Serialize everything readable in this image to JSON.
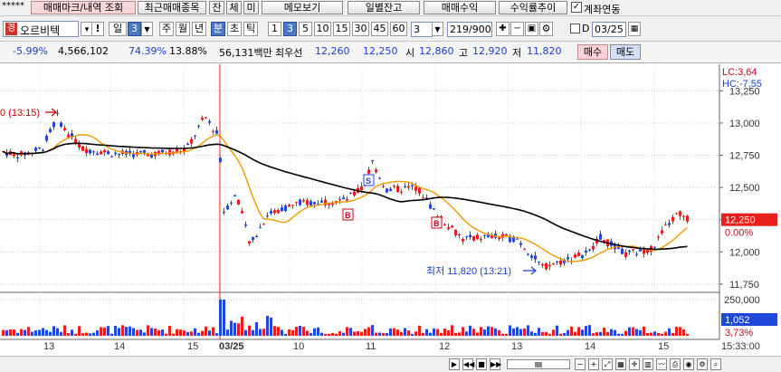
{
  "toolbar": {
    "stars": "*****",
    "trade_mark_view": "매매마크/내역 조회",
    "recent_items": "최근매매종목",
    "jan": "잔",
    "che": "체",
    "mi": "미",
    "memo": "메모보기",
    "daily_balance": "일별잔고",
    "trade_profit": "매매수익",
    "return_trend": "수익률추이",
    "account_link_label": "계좌연동",
    "account_link_checked": true
  },
  "stock_bar": {
    "prefix_badge": "경",
    "stock_name": "오르비텍",
    "warn": "!",
    "period_daily": "일",
    "period_num": "3",
    "week": "주",
    "month": "월",
    "year": "년",
    "minute": "분",
    "second": "초",
    "tick": "틱",
    "intervals": [
      "1",
      "3",
      "5",
      "10",
      "15",
      "30",
      "45",
      "60"
    ],
    "selected_interval": "3",
    "count_value": "3",
    "page_counter": "219/900",
    "checkbox_d_label": "D",
    "date_value": "03/25"
  },
  "quote": {
    "change_pct": "-5.99%",
    "volume": "4,566,102",
    "vol_ratio": "74.39%",
    "turnover": "13.88%",
    "trade_value": "56,131백만",
    "best_ask_label": "최우선",
    "best_ask": "12,260",
    "best_bid": "12,250",
    "open_label": "시",
    "open": "12,860",
    "high_label": "고",
    "high": "12,920",
    "low_label": "저",
    "low": "11,820",
    "buy_btn": "매수",
    "sell_btn": "매도"
  },
  "chart_data": {
    "type": "candlestick",
    "x_labels": [
      "13",
      "14",
      "15",
      "03/25",
      "10",
      "11",
      "12",
      "13",
      "14",
      "15",
      "15:33:00"
    ],
    "y_ticks": [
      "13,250",
      "13,000",
      "12,750",
      "12,500",
      "12,250",
      "12,000",
      "11,750"
    ],
    "ylim": [
      11700,
      13400
    ],
    "volume_tick": "250,000",
    "lc_label": "LC:3,64",
    "hc_label": "HC:-7,55",
    "current_price": "12,250",
    "current_change": "0.00%",
    "volume_current": "1,052",
    "volume_change": "3,73%",
    "annotation_high": "0 (13:15)",
    "annotation_low": "최저 11,820 (13:21)",
    "marker_s": "S",
    "marker_b": "B",
    "colors": {
      "up": "#e8201c",
      "down": "#1f47d8",
      "ma_short": "#f39800",
      "ma_long": "#000000",
      "price_badge": "#e8201c",
      "vol_badge": "#1f47d8"
    }
  }
}
